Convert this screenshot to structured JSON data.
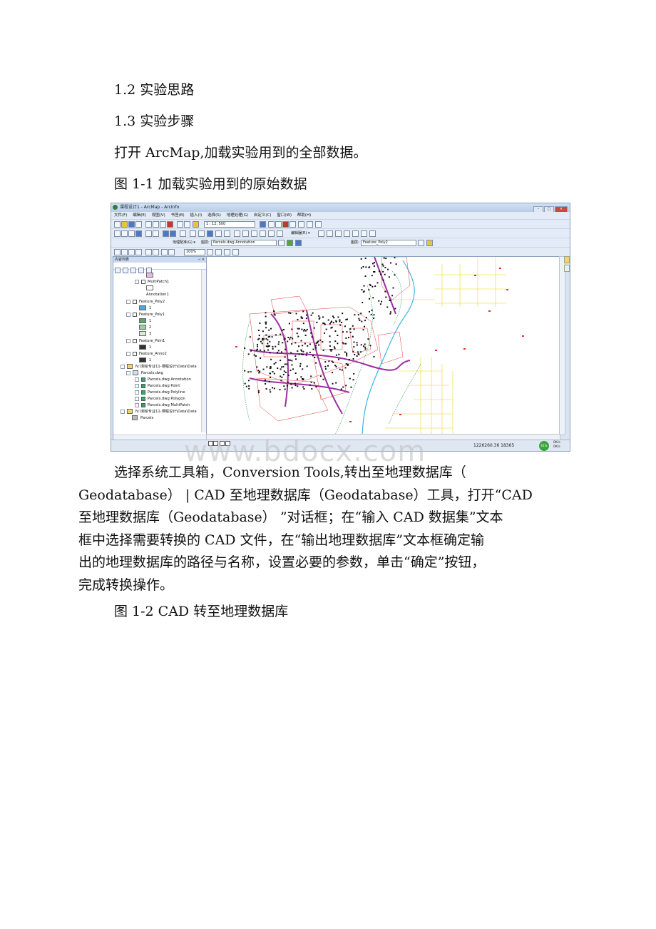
{
  "doc": {
    "heading_1_2": "1.2 实验思路",
    "heading_1_3": "1.3 实验步骤",
    "step_text": "打开 ArcMap,加载实验用到的全部数据。",
    "fig_1_1_caption": "图 1-1 加载实验用到的原始数据",
    "paragraph_lines": [
      "选择系统工具箱，Conversion Tools,转出至地理数据库（",
      "Geodatabase） | CAD 至地理数据库（Geodatabase）工具，打开“CAD",
      "至地理数据库（Geodatabase） ”对话框；在“输入 CAD 数据集”文本",
      "框中选择需要转换的 CAD 文件，在“输出地理数据库”文本框确定输",
      "出的地理数据库的路径与名称，设置必要的参数，单击“确定”按钮，",
      "完成转换操作。"
    ],
    "fig_1_2_caption": "图 1-2 CAD 转至地理数据库",
    "watermark": "www.bdocx.com"
  },
  "arcmap": {
    "window_title": "课程设计1 - ArcMap - ArcInfo",
    "menu": [
      "文件(F)",
      "编辑(E)",
      "视图(V)",
      "书签(B)",
      "插入(I)",
      "选择(S)",
      "地理处理(G)",
      "自定义(C)",
      "窗口(W)",
      "帮助(H)"
    ],
    "scale": "1 : 12, 500",
    "georef_label": "地理配准(G) ▾",
    "layer_label_1": "图层:",
    "layer_value_1": "Parcels.dwg Annotation",
    "editor_label": "编辑器(R) ▾",
    "layer_label_2": "图层:",
    "layer_value_2": "Feature_Poly2",
    "zoom_value": "100%",
    "toc_title": "内容列表",
    "toc_items": [
      {
        "text": "MultiPatch1",
        "kind": "layer"
      },
      {
        "text": "Annotation1",
        "kind": "sub"
      },
      {
        "text": "Feature_Poly2",
        "kind": "layer"
      },
      {
        "text": "1",
        "kind": "sub"
      },
      {
        "text": "Feature_Poly1",
        "kind": "layer"
      },
      {
        "text": "1",
        "kind": "sub"
      },
      {
        "text": "2",
        "kind": "sub"
      },
      {
        "text": "3",
        "kind": "sub"
      },
      {
        "text": "Feature_Poin1",
        "kind": "layer"
      },
      {
        "text": "1",
        "kind": "sub"
      },
      {
        "text": "Feature_Anno2",
        "kind": "layer"
      },
      {
        "text": "1",
        "kind": "sub"
      },
      {
        "text": "N:\\测绘专业11-课程设计\\Data\\Data",
        "kind": "folder"
      },
      {
        "text": "Parcels.dwg",
        "kind": "dwg"
      },
      {
        "text": "Parcels.dwg Annotation",
        "kind": "checked"
      },
      {
        "text": "Parcels.dwg Point",
        "kind": "checked"
      },
      {
        "text": "Parcels.dwg Polyline",
        "kind": "checked"
      },
      {
        "text": "Parcels.dwg Polygon",
        "kind": "checked"
      },
      {
        "text": "Parcels.dwg MultiPatch",
        "kind": "checked"
      },
      {
        "text": "N:\\测绘专业11-课程设计\\Data\\Data",
        "kind": "folder"
      },
      {
        "text": "Parcels",
        "kind": "sub"
      }
    ],
    "coordinates": "1226260.36  18365",
    "tray_percent": "61%",
    "net_up": "0K/s",
    "net_down": "0K/s"
  }
}
